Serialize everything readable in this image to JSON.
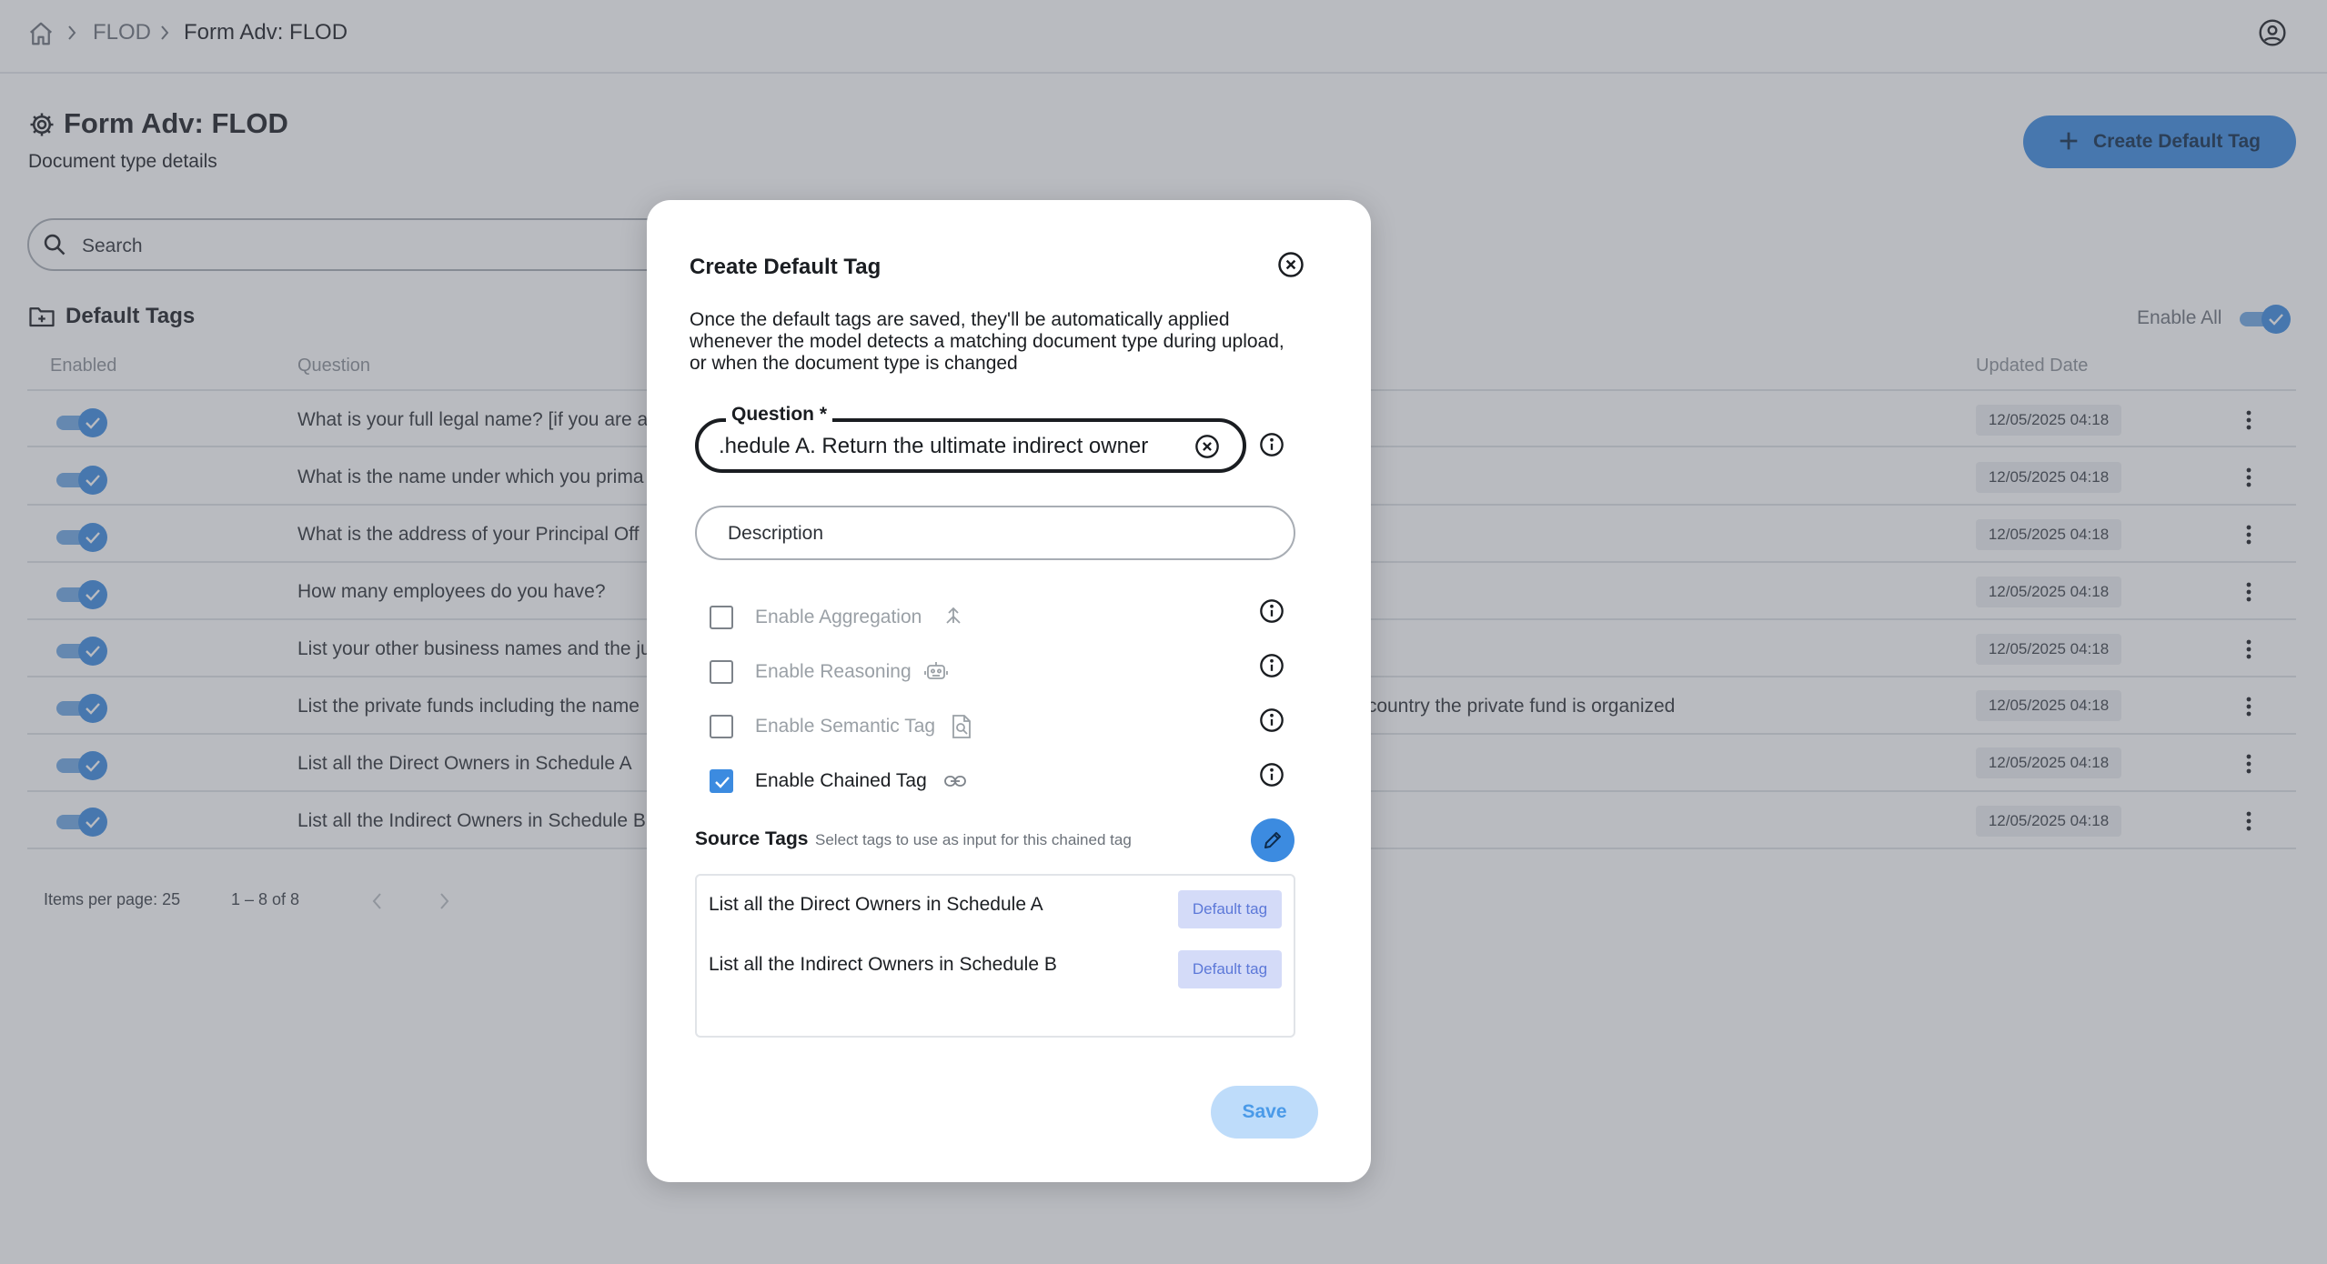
{
  "breadcrumb": {
    "items": [
      "FLOD",
      "Form Adv: FLOD"
    ]
  },
  "page": {
    "title": "Form Adv: FLOD",
    "subtitle": "Document type details",
    "create_button_label": "Create Default Tag",
    "search_placeholder": "Search",
    "section_title": "Default Tags",
    "enable_all_label": "Enable All"
  },
  "table": {
    "columns": [
      "Enabled",
      "Question",
      "Updated Date"
    ],
    "rows": [
      {
        "question": "What is your full legal name? [if you are a",
        "extra": "",
        "date": "12/05/2025 04:18",
        "enabled": true
      },
      {
        "question": "What is the name under which you prima",
        "extra": "",
        "date": "12/05/2025 04:18",
        "enabled": true
      },
      {
        "question": "What is the address of your Principal Off",
        "extra": "",
        "date": "12/05/2025 04:18",
        "enabled": true
      },
      {
        "question": "How many employees do you have?",
        "extra": "",
        "date": "12/05/2025 04:18",
        "enabled": true
      },
      {
        "question": "List your other business names and the ju",
        "extra": "",
        "date": "12/05/2025 04:18",
        "enabled": true
      },
      {
        "question": "List the private funds including the name",
        "extra": "r country the private fund is organized",
        "date": "12/05/2025 04:18",
        "enabled": true
      },
      {
        "question": "List all the Direct Owners in Schedule A",
        "extra": "",
        "date": "12/05/2025 04:18",
        "enabled": true
      },
      {
        "question": "List all the Indirect Owners in Schedule B",
        "extra": "",
        "date": "12/05/2025 04:18",
        "enabled": true
      }
    ]
  },
  "pagination": {
    "items_per_page": "Items per page: 25",
    "range": "1 – 8 of 8"
  },
  "modal": {
    "title": "Create Default Tag",
    "description": "Once the default tags are saved, they'll be automatically applied whenever the model detects a matching document type during upload, or when the document type is changed",
    "question_label": "Question *",
    "question_value": "hedule A. Return the ultimate indirect owner.",
    "description_placeholder": "Description",
    "options": [
      {
        "label": "Enable Aggregation",
        "checked": false,
        "icon": "aggregation-icon"
      },
      {
        "label": "Enable Reasoning",
        "checked": false,
        "icon": "robot-icon"
      },
      {
        "label": "Enable Semantic Tag",
        "checked": false,
        "icon": "document-search-icon"
      },
      {
        "label": "Enable Chained Tag",
        "checked": true,
        "icon": "link-icon"
      }
    ],
    "source_tags_title": "Source Tags",
    "source_tags_hint": "Select tags to use as input for this chained tag",
    "source_tags": [
      {
        "name": "List all the Direct Owners in Schedule A",
        "badge": "Default tag"
      },
      {
        "name": "List all the Indirect Owners in Schedule B",
        "badge": "Default tag"
      }
    ],
    "save_label": "Save"
  },
  "colors": {
    "accent": "#3c8be0",
    "chip_bg": "#d4dbf8",
    "chip_text": "#5c78d8"
  }
}
